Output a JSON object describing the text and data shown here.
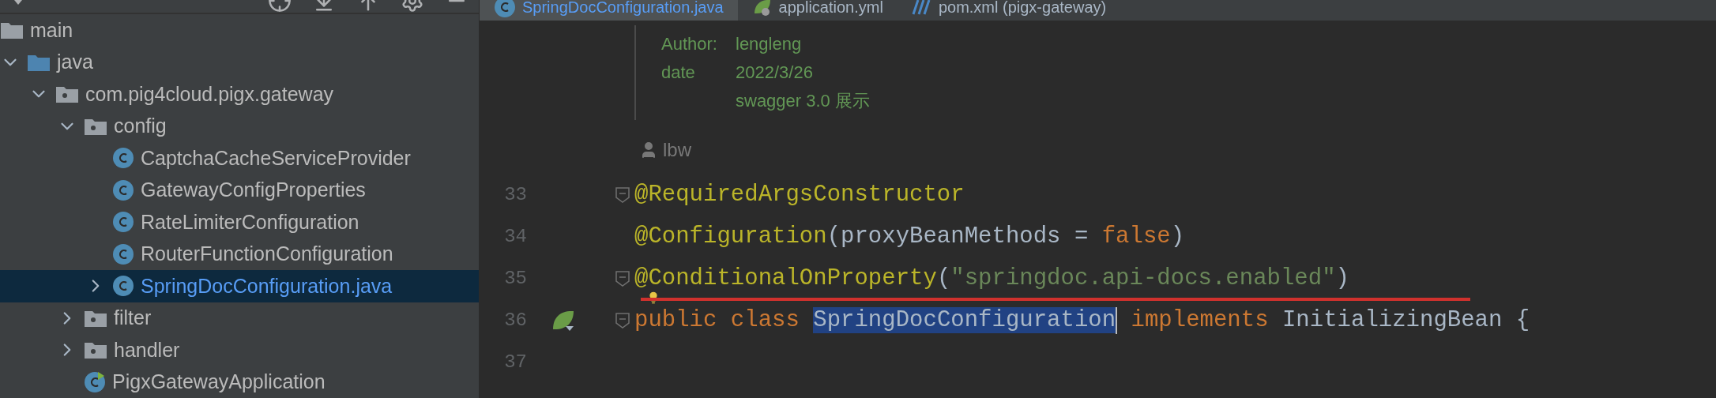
{
  "project_tree": {
    "items": [
      {
        "label": "main",
        "kind": "source-folder",
        "selected": false,
        "children": [
          {
            "label": "java",
            "kind": "java-folder",
            "expanded": true,
            "selected": false,
            "children": [
              {
                "label": "com.pig4cloud.pigx.gateway",
                "kind": "package",
                "expanded": true,
                "selected": false,
                "children": [
                  {
                    "label": "config",
                    "kind": "package",
                    "expanded": true,
                    "selected": false,
                    "children": [
                      {
                        "label": "CaptchaCacheServiceProvider",
                        "kind": "class",
                        "selected": false
                      },
                      {
                        "label": "GatewayConfigProperties",
                        "kind": "class",
                        "selected": false
                      },
                      {
                        "label": "RateLimiterConfiguration",
                        "kind": "class",
                        "selected": false
                      },
                      {
                        "label": "RouterFunctionConfiguration",
                        "kind": "class",
                        "selected": false
                      },
                      {
                        "label": "SpringDocConfiguration.java",
                        "kind": "class",
                        "expanded": false,
                        "selected": true
                      }
                    ]
                  },
                  {
                    "label": "filter",
                    "kind": "package",
                    "expanded": false,
                    "selected": false
                  },
                  {
                    "label": "handler",
                    "kind": "package",
                    "expanded": false,
                    "selected": false
                  },
                  {
                    "label": "PigxGatewayApplication",
                    "kind": "application",
                    "selected": false
                  }
                ]
              }
            ]
          }
        ]
      }
    ]
  },
  "editor_tabs": [
    {
      "label": "SpringDocConfiguration.java",
      "kind": "class",
      "selected": true
    },
    {
      "label": "application.yml",
      "kind": "yaml",
      "selected": false
    },
    {
      "label": "pom.xml (pigx-gateway)",
      "kind": "maven",
      "selected": false
    }
  ],
  "doc_comment": [
    {
      "key": "Author:",
      "value": "lengleng"
    },
    {
      "key": "date",
      "value": "2022/3/26"
    },
    {
      "value": "swagger 3.0 展示"
    }
  ],
  "code_author": "lbw",
  "code_lines": [
    {
      "number": "33",
      "fold": true,
      "bean_marker": false,
      "intention": false,
      "underlined": false,
      "tokens": [
        {
          "text": "@RequiredArgsConstructor",
          "kind": "annotation"
        }
      ]
    },
    {
      "number": "34",
      "fold": false,
      "bean_marker": false,
      "intention": false,
      "underlined": false,
      "tokens": [
        {
          "text": "@Configuration",
          "kind": "annotation"
        },
        {
          "text": "(proxyBeanMethods = ",
          "kind": "plain"
        },
        {
          "text": "false",
          "kind": "keyword"
        },
        {
          "text": ")",
          "kind": "plain"
        }
      ]
    },
    {
      "number": "35",
      "fold": true,
      "bean_marker": false,
      "intention": true,
      "underlined": true,
      "tokens": [
        {
          "text": "@ConditionalOnProperty",
          "kind": "annotation"
        },
        {
          "text": "(",
          "kind": "plain"
        },
        {
          "text": "\"springdoc.api-docs.enabled\"",
          "kind": "string"
        },
        {
          "text": ")",
          "kind": "plain"
        }
      ]
    },
    {
      "number": "36",
      "fold": true,
      "bean_marker": true,
      "intention": false,
      "underlined": false,
      "tokens": [
        {
          "text": "public class ",
          "kind": "keyword"
        },
        {
          "text": "SpringDocConfiguration",
          "kind": "selected"
        },
        {
          "text": " implements ",
          "kind": "keyword"
        },
        {
          "text": "InitializingBean {",
          "kind": "plain"
        }
      ]
    },
    {
      "number": "37",
      "fold": false,
      "bean_marker": false,
      "intention": false,
      "underlined": false
    }
  ]
}
